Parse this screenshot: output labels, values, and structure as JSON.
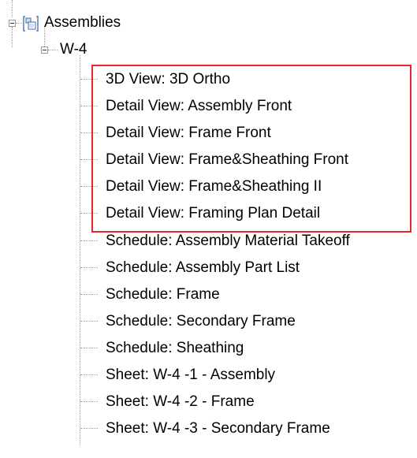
{
  "tree": {
    "root": {
      "label": "Assemblies",
      "icon": "assembly-icon"
    },
    "assembly": {
      "label": "W-4"
    },
    "highlight_color": "#e8262d",
    "items": [
      {
        "label": "3D View: 3D Ortho",
        "highlighted": true
      },
      {
        "label": "Detail View: Assembly Front",
        "highlighted": true
      },
      {
        "label": "Detail View: Frame Front",
        "highlighted": true
      },
      {
        "label": "Detail View: Frame&Sheathing Front",
        "highlighted": true
      },
      {
        "label": "Detail View: Frame&Sheathing II",
        "highlighted": true
      },
      {
        "label": "Detail View: Framing Plan Detail",
        "highlighted": true
      },
      {
        "label": "Schedule: Assembly Material Takeoff",
        "highlighted": false
      },
      {
        "label": "Schedule: Assembly Part List",
        "highlighted": false
      },
      {
        "label": "Schedule: Frame",
        "highlighted": false
      },
      {
        "label": "Schedule: Secondary Frame",
        "highlighted": false
      },
      {
        "label": "Schedule: Sheathing",
        "highlighted": false
      },
      {
        "label": "Sheet: W-4 -1 - Assembly",
        "highlighted": false
      },
      {
        "label": "Sheet: W-4 -2 - Frame",
        "highlighted": false
      },
      {
        "label": "Sheet: W-4 -3 - Secondary Frame",
        "highlighted": false
      }
    ]
  }
}
